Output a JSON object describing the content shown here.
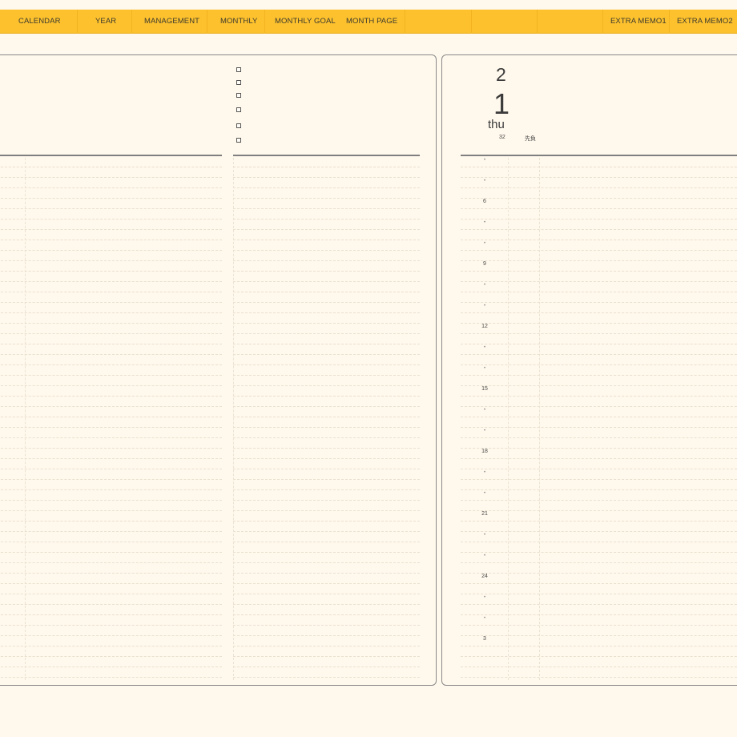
{
  "nav": {
    "tabs_left": [
      {
        "id": "calendar",
        "label": "CALENDAR"
      },
      {
        "id": "year",
        "label": "YEAR"
      },
      {
        "id": "management",
        "label": "MANAGEMENT"
      },
      {
        "id": "monthly",
        "label": "MONTHLY"
      },
      {
        "id": "monthly-goal",
        "label": "MONTHLY GOAL"
      },
      {
        "id": "month-page",
        "label": "MONTH PAGE"
      }
    ],
    "tabs_right": [
      {
        "id": "extra-memo1",
        "label": "EXTRA MEMO1"
      },
      {
        "id": "extra-memo2",
        "label": "EXTRA MEMO2"
      }
    ],
    "bar_color": "#fcc12d"
  },
  "right_page": {
    "month": "2",
    "day": "1",
    "weekday": "thu",
    "week_number": "32",
    "note": "先負",
    "hour_labels": [
      "6",
      "9",
      "12",
      "15",
      "18",
      "21",
      "24",
      "3"
    ],
    "tick_mark": "•"
  }
}
